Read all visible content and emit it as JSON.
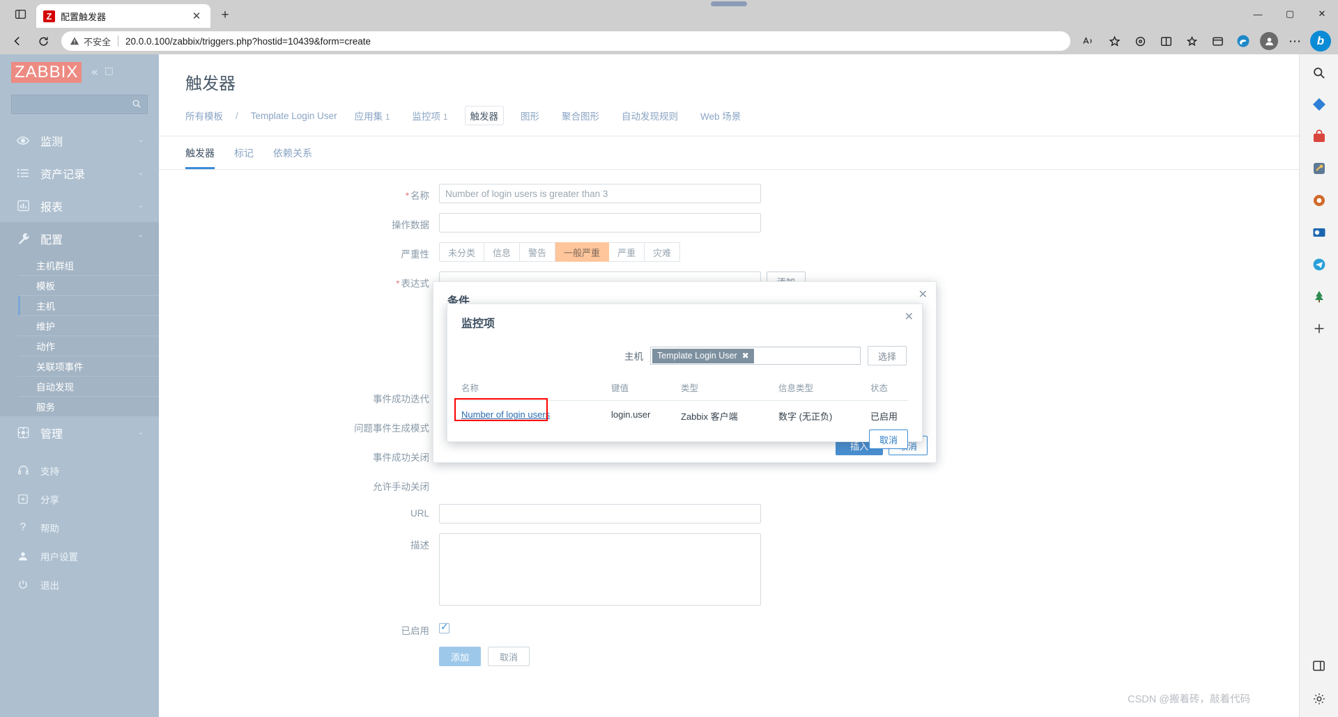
{
  "browser": {
    "tab": {
      "title": "配置触发器",
      "favicon_letter": "Z",
      "close_label": "✕"
    },
    "new_tab_label": "+",
    "collections_icon": "tab-sidebar-icon",
    "window_controls": {
      "minimize": "—",
      "maximize": "▢",
      "close": "✕"
    },
    "toolbar": {
      "back": "←",
      "reload": "⟳",
      "not_secure_text": "不安全",
      "url": "20.0.0.100/zabbix/triggers.php?hostid=10439&form=create",
      "url_host": "20.0.0.100",
      "url_path": "/zabbix/triggers.php?hostid=10439&form=create",
      "read_aloud": "A",
      "favorite": "☆",
      "extensions": "⚙",
      "split_screen": "◫",
      "collections": "✦",
      "browser_essentials": "▤",
      "edge_copilot": "e",
      "profile": "person-icon",
      "settings_more": "⋯",
      "bing_label": "b"
    }
  },
  "sidebar": {
    "logo": "ZABBIX",
    "collapse_icon": "«",
    "pin_icon": "⛶",
    "search_placeholder": "",
    "search_value": "",
    "nav": [
      {
        "label": "监测",
        "icon": "eye-icon",
        "caret": "⌄",
        "active": false
      },
      {
        "label": "资产记录",
        "icon": "list-icon",
        "caret": "⌄",
        "active": false
      },
      {
        "label": "报表",
        "icon": "chart-icon",
        "caret": "⌄",
        "active": false
      },
      {
        "label": "配置",
        "icon": "wrench-icon",
        "caret": "⌃",
        "active": true
      }
    ],
    "submenu": [
      {
        "label": "主机群组",
        "current": false
      },
      {
        "label": "模板",
        "current": false
      },
      {
        "label": "主机",
        "current": true
      },
      {
        "label": "维护",
        "current": false
      },
      {
        "label": "动作",
        "current": false
      },
      {
        "label": "关联项事件",
        "current": false
      },
      {
        "label": "自动发现",
        "current": false
      },
      {
        "label": "服务",
        "current": false
      }
    ],
    "admin": {
      "label": "管理",
      "icon": "gear-icon",
      "caret": "⌄"
    },
    "footer": [
      {
        "label": "支持",
        "icon": "headset-icon"
      },
      {
        "label": "分享",
        "icon": "share-icon"
      },
      {
        "label": "帮助",
        "icon": "question-icon"
      },
      {
        "label": "用户设置",
        "icon": "user-icon"
      },
      {
        "label": "退出",
        "icon": "power-icon"
      }
    ]
  },
  "page": {
    "title": "触发器",
    "breadcrumb": {
      "all_templates": "所有模板",
      "separator": "/",
      "template_name": "Template Login User",
      "tabs": [
        {
          "label": "应用集",
          "count": "1",
          "active": false
        },
        {
          "label": "监控项",
          "count": "1",
          "active": false
        },
        {
          "label": "触发器",
          "count": "",
          "active": true
        },
        {
          "label": "图形",
          "count": "",
          "active": false
        },
        {
          "label": "聚合图形",
          "count": "",
          "active": false
        },
        {
          "label": "自动发现规则",
          "count": "",
          "active": false
        },
        {
          "label": "Web 场景",
          "count": "",
          "active": false
        }
      ]
    },
    "form_tabs": [
      {
        "label": "触发器",
        "active": true
      },
      {
        "label": "标记",
        "active": false
      },
      {
        "label": "依赖关系",
        "active": false
      }
    ]
  },
  "form": {
    "name": {
      "label": "名称",
      "required": true,
      "value": "Number of login users is greater than 3"
    },
    "opdata": {
      "label": "操作数据",
      "value": ""
    },
    "severity": {
      "label": "严重性",
      "options": [
        "未分类",
        "信息",
        "警告",
        "一般严重",
        "严重",
        "灾难"
      ],
      "selected": "一般严重"
    },
    "expression": {
      "label": "表达式",
      "required": true,
      "value": "",
      "add_button": "添加"
    },
    "event_generation_labels": {
      "ok_event": "事件成功迭代",
      "problem_event_mode": "问题事件生成模式",
      "ok_event_closes": "事件成功关闭",
      "allow_manual_close": "允许手动关闭"
    },
    "url": {
      "label": "URL",
      "value": ""
    },
    "description": {
      "label": "描述",
      "value": ""
    },
    "enabled": {
      "label": "已启用",
      "checked": true
    },
    "actions": {
      "add": "添加",
      "cancel": "取消"
    }
  },
  "overlay_condition": {
    "title": "条件",
    "close": "✕",
    "buttons": {
      "insert": "插入",
      "cancel": "取消"
    }
  },
  "overlay_item": {
    "title": "监控项",
    "close": "✕",
    "host": {
      "label": "主机",
      "chip": "Template Login User",
      "chip_remove": "✖",
      "select_button": "选择"
    },
    "table": {
      "columns": [
        "名称",
        "键值",
        "类型",
        "信息类型",
        "状态"
      ],
      "rows": [
        {
          "name": "Number of login users",
          "key": "login.user",
          "type": "Zabbix 客户端",
          "value_type": "数字 (无正负)",
          "status": "已启用",
          "highlighted": true
        }
      ]
    },
    "cancel_button": "取消"
  },
  "right_rail": {
    "icons": [
      {
        "name": "search-icon",
        "glyph": "🔍",
        "color": "#333333"
      },
      {
        "name": "diamond-blue-icon",
        "glyph": "◆",
        "color": "#2f7fd6"
      },
      {
        "name": "shopping-bag-icon",
        "glyph": "▤",
        "color": "#d9463e"
      },
      {
        "name": "tools-icon",
        "glyph": "⚒",
        "color": "#e0a13a"
      },
      {
        "name": "office-icon",
        "glyph": "◍",
        "color": "#d06a2a"
      },
      {
        "name": "outlook-icon",
        "glyph": "✉",
        "color": "#1b66b0"
      },
      {
        "name": "telegram-icon",
        "glyph": "➤",
        "color": "#2aa0d8"
      },
      {
        "name": "tree-icon",
        "glyph": "▲",
        "color": "#2e8b4f"
      },
      {
        "name": "add-icon",
        "glyph": "＋",
        "color": "#444444"
      }
    ],
    "bottom_icons": [
      {
        "name": "split-pane-icon",
        "glyph": "◫",
        "color": "#333333"
      },
      {
        "name": "settings-gear-icon",
        "glyph": "⚙",
        "color": "#333333"
      }
    ]
  },
  "watermark": "CSDN @搬着砖，敲着代码"
}
